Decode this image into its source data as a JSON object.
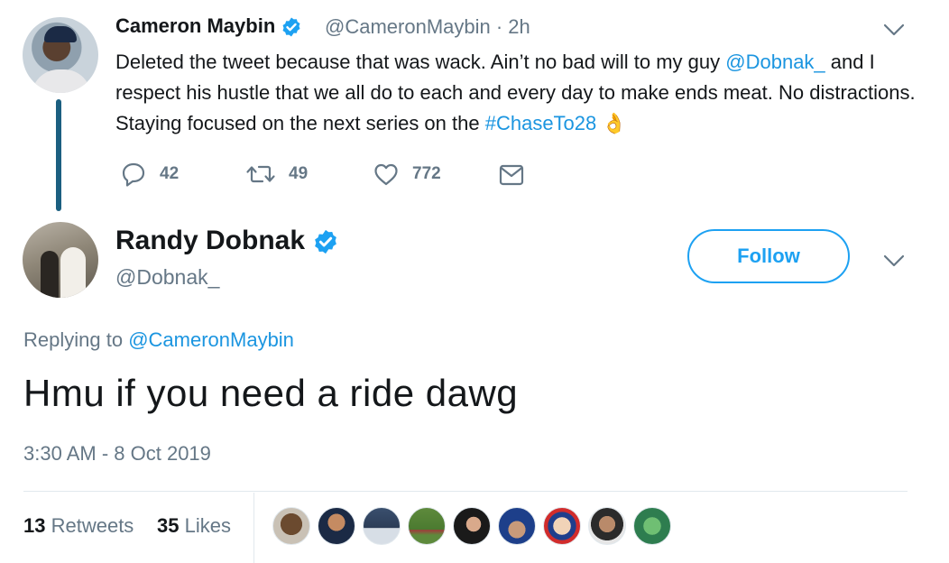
{
  "parent_tweet": {
    "name": "Cameron Maybin",
    "handle_time": "@CameronMaybin · 2h",
    "text_1": "Deleted the tweet because that was wack. Ain’t no bad will to my guy ",
    "mention": "@Dobnak_",
    "text_2": " and I respect his hustle that we all do to each and every day to make ends meat. No distractions. Staying focused on the next series on the ",
    "hashtag": "#ChaseTo28",
    "emoji": "👌",
    "reply_count": "42",
    "retweet_count": "49",
    "like_count": "772"
  },
  "main_tweet": {
    "name": "Randy Dobnak",
    "handle": "@Dobnak_",
    "follow_label": "Follow",
    "replying_prefix": "Replying to ",
    "replying_handle": "@CameronMaybin",
    "body": "Hmu if you need a ride dawg",
    "timestamp": "3:30 AM - 8 Oct 2019",
    "retweets_count": "13",
    "retweets_label": " Retweets",
    "likes_count": "35",
    "likes_label": " Likes"
  },
  "colors": {
    "link": "#1b95e0",
    "verified": "#1da1f2",
    "secondary_text": "#657786",
    "thread_line": "#1b5f80"
  },
  "icons": [
    "verified-badge-icon",
    "reply-icon",
    "retweet-icon",
    "like-icon",
    "message-icon",
    "chevron-down-icon"
  ],
  "liker_avatars": [
    "liker-avatar-1",
    "liker-avatar-2",
    "liker-avatar-3",
    "liker-avatar-4",
    "liker-avatar-5",
    "liker-avatar-6",
    "liker-avatar-7",
    "liker-avatar-8",
    "liker-avatar-9"
  ]
}
